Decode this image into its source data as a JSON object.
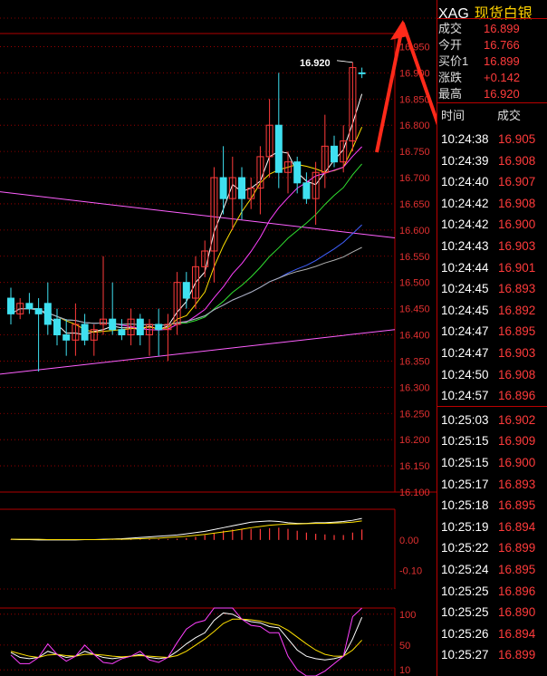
{
  "instrument": {
    "code": "XAG",
    "name": "现货白银"
  },
  "quote": [
    {
      "label": "成交",
      "value": "16.899"
    },
    {
      "label": "今开",
      "value": "16.766"
    },
    {
      "label": "买价1",
      "value": "16.899"
    },
    {
      "label": "涨跌",
      "value": "+0.142"
    },
    {
      "label": "最高",
      "value": "16.920"
    }
  ],
  "ticks_header": {
    "time": "时间",
    "price": "成交"
  },
  "ticks": [
    {
      "time": "10:24:38",
      "price": "16.905"
    },
    {
      "time": "10:24:39",
      "price": "16.908"
    },
    {
      "time": "10:24:40",
      "price": "16.907"
    },
    {
      "time": "10:24:42",
      "price": "16.908"
    },
    {
      "time": "10:24:42",
      "price": "16.900"
    },
    {
      "time": "10:24:43",
      "price": "16.903"
    },
    {
      "time": "10:24:44",
      "price": "16.901"
    },
    {
      "time": "10:24:45",
      "price": "16.893"
    },
    {
      "time": "10:24:45",
      "price": "16.892"
    },
    {
      "time": "10:24:47",
      "price": "16.895"
    },
    {
      "time": "10:24:47",
      "price": "16.903"
    },
    {
      "time": "10:24:50",
      "price": "16.908"
    },
    {
      "time": "10:24:57",
      "price": "16.896"
    },
    {
      "time": "10:25:03",
      "price": "16.902"
    },
    {
      "time": "10:25:15",
      "price": "16.909"
    },
    {
      "time": "10:25:15",
      "price": "16.900"
    },
    {
      "time": "10:25:17",
      "price": "16.893"
    },
    {
      "time": "10:25:18",
      "price": "16.895"
    },
    {
      "time": "10:25:19",
      "price": "16.894"
    },
    {
      "time": "10:25:22",
      "price": "16.899"
    },
    {
      "time": "10:25:24",
      "price": "16.895"
    },
    {
      "time": "10:25:25",
      "price": "16.896"
    },
    {
      "time": "10:25:25",
      "price": "16.890"
    },
    {
      "time": "10:25:26",
      "price": "16.894"
    },
    {
      "time": "10:25:27",
      "price": "16.899"
    }
  ],
  "colors": {
    "up": "#ff3b3b",
    "down": "#3fe0f0",
    "grid": "#b00000",
    "axis_text": "#e03030"
  },
  "chart_data": {
    "type": "candlestick",
    "price_axis": {
      "ticks": [
        "16.950",
        "16.900",
        "16.850",
        "16.800",
        "16.750",
        "16.700",
        "16.650",
        "16.600",
        "16.550",
        "16.500",
        "16.450",
        "16.400",
        "16.350",
        "16.300",
        "16.250",
        "16.200",
        "16.150",
        "16.100"
      ],
      "ylim": [
        16.1,
        16.975
      ]
    },
    "high_annotation": "16.920",
    "candles": [
      {
        "o": 16.47,
        "h": 16.49,
        "l": 16.42,
        "c": 16.44
      },
      {
        "o": 16.44,
        "h": 16.47,
        "l": 16.43,
        "c": 16.46
      },
      {
        "o": 16.46,
        "h": 16.48,
        "l": 16.44,
        "c": 16.45
      },
      {
        "o": 16.45,
        "h": 16.47,
        "l": 16.33,
        "c": 16.44
      },
      {
        "o": 16.46,
        "h": 16.5,
        "l": 16.4,
        "c": 16.42
      },
      {
        "o": 16.43,
        "h": 16.45,
        "l": 16.38,
        "c": 16.4
      },
      {
        "o": 16.4,
        "h": 16.43,
        "l": 16.36,
        "c": 16.39
      },
      {
        "o": 16.39,
        "h": 16.46,
        "l": 16.36,
        "c": 16.42
      },
      {
        "o": 16.42,
        "h": 16.44,
        "l": 16.38,
        "c": 16.39
      },
      {
        "o": 16.39,
        "h": 16.42,
        "l": 16.36,
        "c": 16.41
      },
      {
        "o": 16.42,
        "h": 16.55,
        "l": 16.4,
        "c": 16.43
      },
      {
        "o": 16.43,
        "h": 16.5,
        "l": 16.4,
        "c": 16.41
      },
      {
        "o": 16.41,
        "h": 16.43,
        "l": 16.39,
        "c": 16.4
      },
      {
        "o": 16.4,
        "h": 16.45,
        "l": 16.38,
        "c": 16.43
      },
      {
        "o": 16.43,
        "h": 16.44,
        "l": 16.38,
        "c": 16.4
      },
      {
        "o": 16.4,
        "h": 16.43,
        "l": 16.36,
        "c": 16.42
      },
      {
        "o": 16.42,
        "h": 16.45,
        "l": 16.36,
        "c": 16.41
      },
      {
        "o": 16.41,
        "h": 16.44,
        "l": 16.35,
        "c": 16.42
      },
      {
        "o": 16.42,
        "h": 16.52,
        "l": 16.4,
        "c": 16.5
      },
      {
        "o": 16.5,
        "h": 16.52,
        "l": 16.45,
        "c": 16.47
      },
      {
        "o": 16.47,
        "h": 16.55,
        "l": 16.45,
        "c": 16.53
      },
      {
        "o": 16.53,
        "h": 16.58,
        "l": 16.51,
        "c": 16.56
      },
      {
        "o": 16.56,
        "h": 16.72,
        "l": 16.5,
        "c": 16.7
      },
      {
        "o": 16.7,
        "h": 16.76,
        "l": 16.63,
        "c": 16.66
      },
      {
        "o": 16.66,
        "h": 16.74,
        "l": 16.6,
        "c": 16.7
      },
      {
        "o": 16.7,
        "h": 16.72,
        "l": 16.62,
        "c": 16.66
      },
      {
        "o": 16.66,
        "h": 16.7,
        "l": 16.64,
        "c": 16.68
      },
      {
        "o": 16.68,
        "h": 16.76,
        "l": 16.63,
        "c": 16.74
      },
      {
        "o": 16.74,
        "h": 16.85,
        "l": 16.7,
        "c": 16.8
      },
      {
        "o": 16.8,
        "h": 16.9,
        "l": 16.68,
        "c": 16.71
      },
      {
        "o": 16.71,
        "h": 16.75,
        "l": 16.67,
        "c": 16.73
      },
      {
        "o": 16.73,
        "h": 16.74,
        "l": 16.67,
        "c": 16.69
      },
      {
        "o": 16.69,
        "h": 16.71,
        "l": 16.65,
        "c": 16.66
      },
      {
        "o": 16.66,
        "h": 16.73,
        "l": 16.61,
        "c": 16.71
      },
      {
        "o": 16.71,
        "h": 16.82,
        "l": 16.68,
        "c": 16.76
      },
      {
        "o": 16.76,
        "h": 16.78,
        "l": 16.72,
        "c": 16.73
      },
      {
        "o": 16.73,
        "h": 16.8,
        "l": 16.71,
        "c": 16.77
      },
      {
        "o": 16.77,
        "h": 16.92,
        "l": 16.75,
        "c": 16.91
      },
      {
        "o": 16.9,
        "h": 16.91,
        "l": 16.89,
        "c": 16.899
      }
    ],
    "macd_axis": {
      "ticks": [
        "0.00",
        "-0.10"
      ],
      "ylim": [
        -0.16,
        0.1
      ]
    },
    "macd_hist": [
      0.002,
      0.002,
      0.002,
      0.001,
      0.001,
      0.001,
      0.001,
      0.001,
      0.001,
      0.001,
      0.001,
      0.002,
      0.002,
      0.002,
      0.002,
      0.003,
      0.003,
      0.003,
      0.004,
      0.006,
      0.01,
      0.016,
      0.022,
      0.03,
      0.034,
      0.036,
      0.036,
      0.036,
      0.038,
      0.04,
      0.036,
      0.03,
      0.024,
      0.02,
      0.018,
      0.016,
      0.016,
      0.024,
      0.034
    ],
    "macd_dif": [
      0.002,
      0.001,
      0.001,
      0.0,
      0.0,
      0.0,
      0.0,
      0.0,
      0.001,
      0.001,
      0.002,
      0.003,
      0.004,
      0.006,
      0.008,
      0.01,
      0.012,
      0.014,
      0.016,
      0.02,
      0.024,
      0.028,
      0.034,
      0.04,
      0.046,
      0.052,
      0.058,
      0.06,
      0.062,
      0.06,
      0.056,
      0.054,
      0.054,
      0.056,
      0.056,
      0.058,
      0.06,
      0.064,
      0.07
    ],
    "macd_dea": [
      0.002,
      0.002,
      0.002,
      0.002,
      0.001,
      0.001,
      0.001,
      0.001,
      0.001,
      0.001,
      0.001,
      0.002,
      0.002,
      0.003,
      0.004,
      0.005,
      0.006,
      0.008,
      0.01,
      0.012,
      0.015,
      0.018,
      0.022,
      0.026,
      0.03,
      0.035,
      0.04,
      0.044,
      0.048,
      0.05,
      0.052,
      0.052,
      0.053,
      0.054,
      0.054,
      0.055,
      0.056,
      0.058,
      0.062
    ],
    "kdj_axis": {
      "ticks": [
        "100",
        "50",
        "10"
      ],
      "ylim": [
        0,
        110
      ]
    },
    "kdj_k": [
      38,
      30,
      28,
      30,
      40,
      35,
      30,
      32,
      40,
      35,
      30,
      28,
      30,
      32,
      35,
      30,
      28,
      30,
      40,
      52,
      62,
      70,
      90,
      102,
      100,
      92,
      88,
      86,
      80,
      78,
      60,
      42,
      32,
      28,
      26,
      28,
      32,
      60,
      95
    ],
    "kdj_d": [
      40,
      36,
      32,
      30,
      34,
      35,
      33,
      32,
      35,
      35,
      34,
      32,
      31,
      32,
      33,
      32,
      31,
      30,
      33,
      40,
      50,
      60,
      72,
      85,
      92,
      92,
      91,
      89,
      85,
      82,
      74,
      63,
      52,
      42,
      35,
      32,
      32,
      42,
      58
    ],
    "kdj_j": [
      34,
      20,
      20,
      30,
      52,
      35,
      24,
      32,
      50,
      35,
      22,
      20,
      28,
      32,
      40,
      26,
      22,
      30,
      54,
      76,
      86,
      90,
      110,
      110,
      110,
      92,
      82,
      80,
      70,
      70,
      32,
      10,
      0,
      0,
      8,
      20,
      32,
      96,
      110
    ]
  }
}
